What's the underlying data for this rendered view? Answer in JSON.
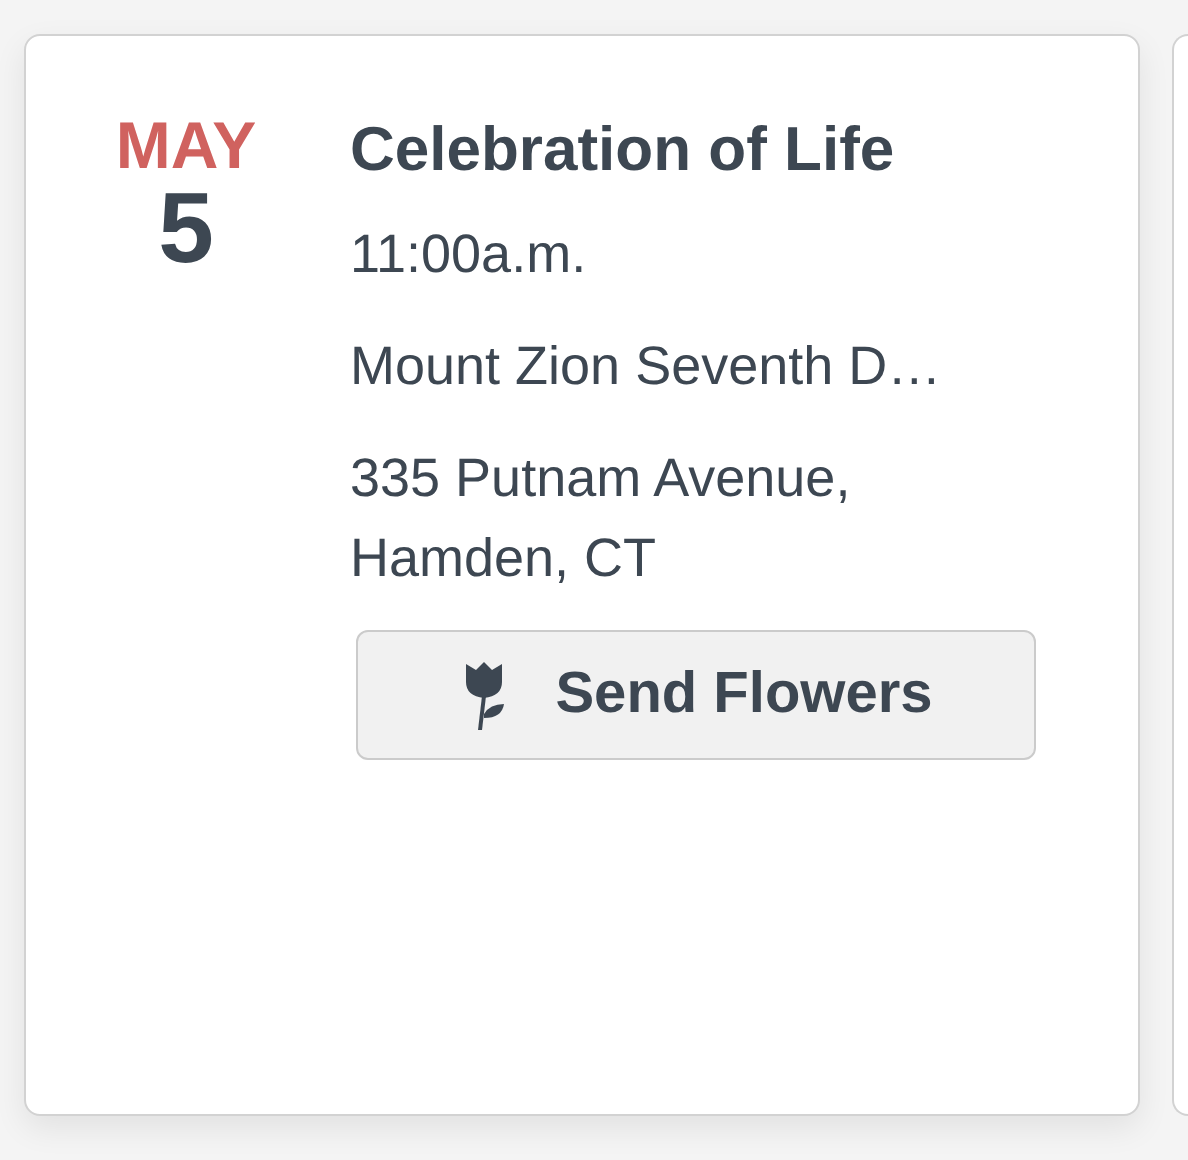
{
  "event": {
    "month": "MAY",
    "day": "5",
    "title": "Celebration of Life",
    "time": "11:00a.m.",
    "venue": "Mount Zion Seventh D…",
    "address": "335 Putnam Avenue, Hamden, CT",
    "button": "Send Flowers"
  }
}
